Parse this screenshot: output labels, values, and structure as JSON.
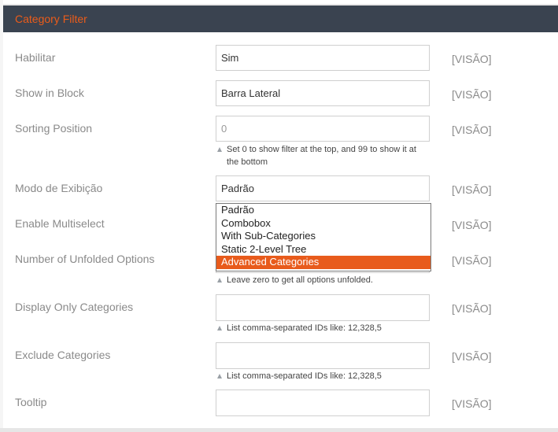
{
  "section": {
    "title": "Category Filter"
  },
  "scope_label": "[VISÃO]",
  "rows": [
    {
      "label": "Habilitar",
      "value": "Sim"
    },
    {
      "label": "Show in Block",
      "value": "Barra Lateral"
    },
    {
      "label": "Sorting Position",
      "value": "0",
      "note": "Set 0 to show filter at the top, and 99 to show it at the bottom"
    },
    {
      "label": "Modo de Exibição",
      "value": "Padrão"
    },
    {
      "label": "Enable Multiselect",
      "value": ""
    },
    {
      "label": "Number of Unfolded Options",
      "value": "",
      "note": "Leave zero to get all options unfolded."
    },
    {
      "label": "Display Only Categories",
      "value": "",
      "note": "List comma-separated IDs like: 12,328,5"
    },
    {
      "label": "Exclude Categories",
      "value": "",
      "note": "List comma-separated IDs like: 12,328,5"
    },
    {
      "label": "Tooltip",
      "value": ""
    }
  ],
  "display_mode_options": [
    "Padrão",
    "Combobox",
    "With Sub-Categories",
    "Static 2-Level Tree",
    "Advanced Categories"
  ],
  "display_mode_highlighted": "Advanced Categories",
  "colors": {
    "header_bg": "#3a4350",
    "accent": "#e85b1c"
  }
}
